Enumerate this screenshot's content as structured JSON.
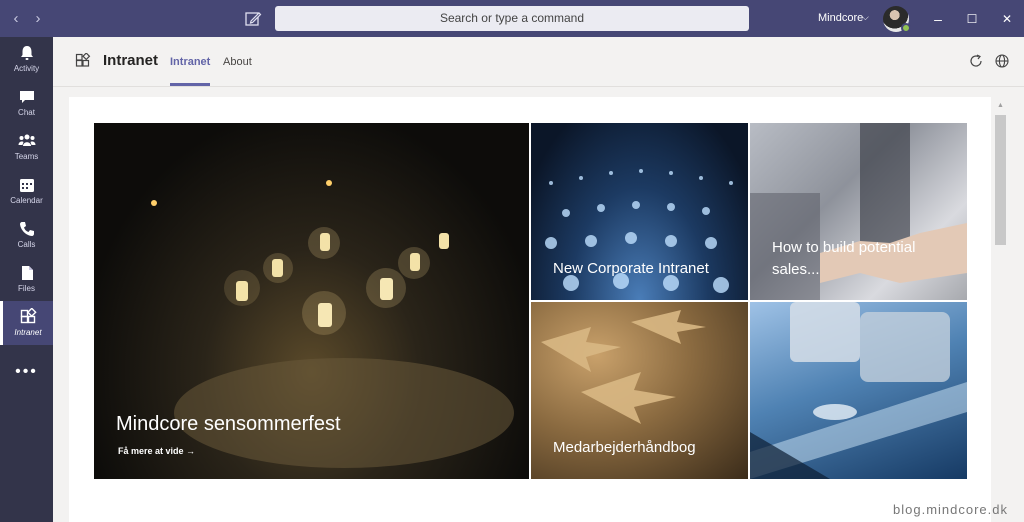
{
  "titlebar": {
    "back_icon": "chevron-left-icon",
    "forward_icon": "chevron-right-icon",
    "compose_icon": "compose-icon",
    "search_placeholder": "Search or type a command",
    "org_name": "Mindcore",
    "org_chevron": "⌵",
    "minimize": "–",
    "maximize": "☐",
    "close": "✕"
  },
  "rail": {
    "items": [
      {
        "label": "Activity",
        "icon": "bell-icon"
      },
      {
        "label": "Chat",
        "icon": "chat-icon"
      },
      {
        "label": "Teams",
        "icon": "teams-icon"
      },
      {
        "label": "Calendar",
        "icon": "calendar-icon"
      },
      {
        "label": "Calls",
        "icon": "phone-icon"
      },
      {
        "label": "Files",
        "icon": "file-icon"
      },
      {
        "label": "Intranet",
        "icon": "intranet-icon"
      }
    ],
    "more": "•••"
  },
  "header": {
    "app_title": "Intranet",
    "tabs": [
      {
        "label": "Intranet",
        "active": true
      },
      {
        "label": "About",
        "active": false
      }
    ]
  },
  "tiles": {
    "hero": {
      "title": "Mindcore sensommerfest",
      "link": "Få mere at vide →"
    },
    "t1": {
      "title": "New Corporate Intranet"
    },
    "t2": {
      "title": "How to build potential sales..."
    },
    "t3": {
      "title": "Medarbejderhåndbog"
    },
    "t4": {
      "title": ""
    }
  },
  "watermark": "blog.mindcore.dk",
  "colors": {
    "titlebar": "#464775",
    "rail": "#33344a",
    "accent": "#6264a7",
    "presence": "#92c353"
  }
}
